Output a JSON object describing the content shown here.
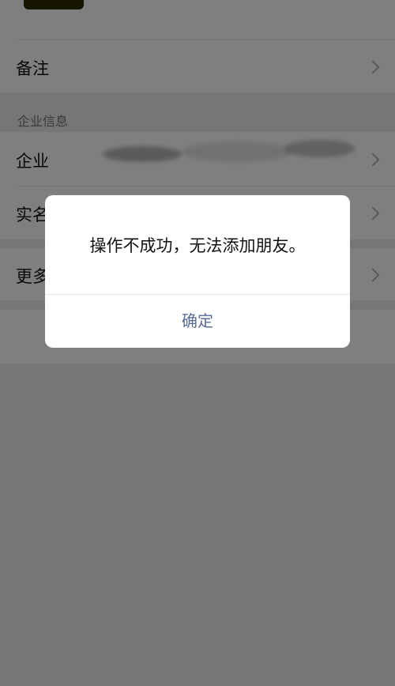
{
  "rows": {
    "remark_label": "备注",
    "section_title": "企业信息",
    "company_label": "企业",
    "realname_label": "实名",
    "more_label": "更多"
  },
  "dialog": {
    "message": "操作不成功，无法添加朋友。",
    "confirm_label": "确定"
  },
  "icons": {
    "chevron": "chevron-right-icon"
  },
  "colors": {
    "confirm_text": "#576b95",
    "overlay": "rgba(0,0,0,0.5)"
  }
}
